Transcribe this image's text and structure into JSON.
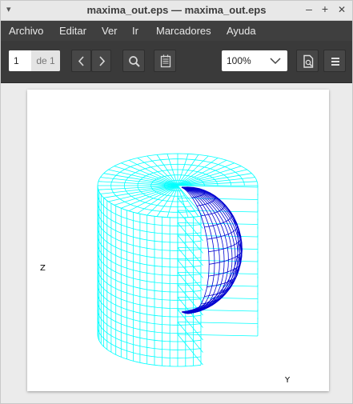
{
  "window": {
    "title": "maxima_out.eps — maxima_out.eps",
    "menu_arrow": "▾",
    "minimize": "–",
    "maximize": "+",
    "close": "✕"
  },
  "menubar": {
    "items": [
      "Archivo",
      "Editar",
      "Ver",
      "Ir",
      "Marcadores",
      "Ayuda"
    ]
  },
  "toolbar": {
    "page_current": "1",
    "page_of": "de 1",
    "zoom": "100%",
    "icons": [
      "go-previous-icon",
      "go-next-icon",
      "search-icon",
      "annotations-icon",
      "print-preview-icon",
      "hamburger-menu-icon"
    ]
  },
  "plot": {
    "z_label": "Z",
    "y_label": "Y",
    "cylinder_color": "#00ffff",
    "sphere_color": "#0000d0"
  }
}
